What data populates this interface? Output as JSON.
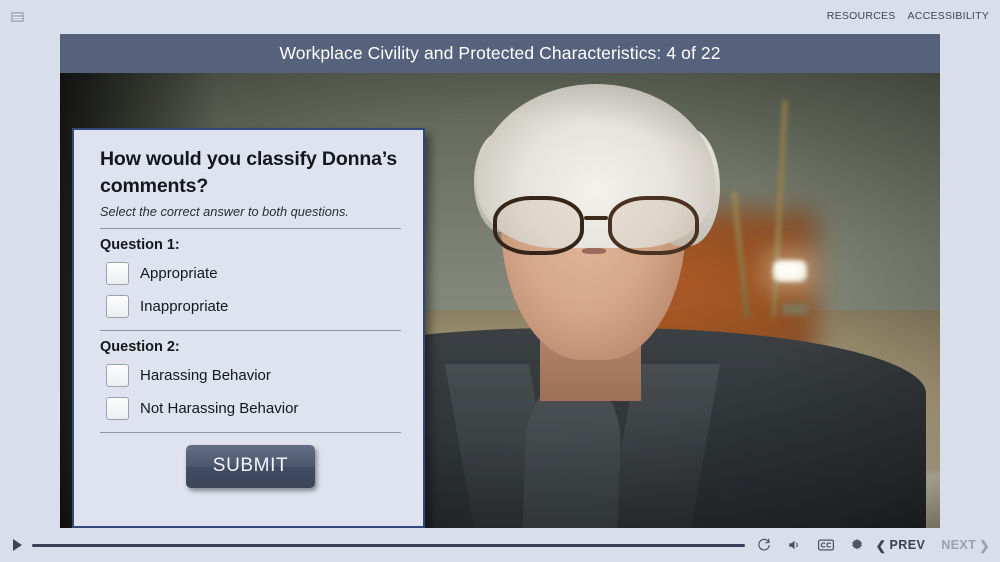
{
  "topbar": {
    "menu_icon": "hamburger-menu-icon",
    "links": [
      "RESOURCES",
      "ACCESSIBILITY"
    ]
  },
  "slide": {
    "title": "Workplace Civility and Protected Characteristics: 4 of 22",
    "current_page": 4,
    "total_pages": 22,
    "title_bar_color": "#56617c"
  },
  "card": {
    "heading": "How would you classify Donna’s comments?",
    "instruction": "Select the correct answer to both questions.",
    "border_color": "#2f4a78",
    "background_color": "#dee3ef",
    "questions": [
      {
        "label": "Question 1:",
        "options": [
          {
            "label": "Appropriate",
            "checked": false
          },
          {
            "label": "Inappropriate",
            "checked": false
          }
        ]
      },
      {
        "label": "Question 2:",
        "options": [
          {
            "label": "Harassing Behavior",
            "checked": false
          },
          {
            "label": "Not Harassing Behavior",
            "checked": false
          }
        ]
      }
    ],
    "submit_label": "SUBMIT",
    "submit_color": "#4b5569"
  },
  "media": {
    "description": "Video still of a woman with short white hair wearing tortoiseshell glasses and a dark blazer in a blurred office interior"
  },
  "controls": {
    "play_icon": "play-icon",
    "progress_percent": 0,
    "icons": [
      {
        "name": "replay-icon",
        "glyph": "↺"
      },
      {
        "name": "volume-icon",
        "glyph": "🔈"
      },
      {
        "name": "closed-captions-icon",
        "glyph": "CC"
      },
      {
        "name": "settings-gear-icon",
        "glyph": "⚙"
      }
    ],
    "prev_label": "PREV",
    "next_label": "NEXT",
    "prev_enabled": true,
    "next_enabled": false
  }
}
